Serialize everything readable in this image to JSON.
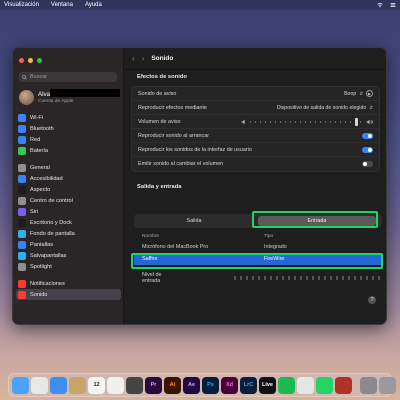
{
  "menubar": {
    "app": "Visualización",
    "items": [
      "Ventana",
      "Ayuda"
    ]
  },
  "window": {
    "title": "Sonido",
    "back_icon": "chevron-left-icon",
    "forward_icon": "chevron-right-icon"
  },
  "sidebar": {
    "search_placeholder": "Buscar",
    "user": {
      "name": "Alvaro",
      "subtitle": "Cuenta de Apple"
    },
    "items": [
      {
        "label": "Wi-Fi",
        "icon": "wifi-icon",
        "color": "#3b82f6"
      },
      {
        "label": "Bluetooth",
        "icon": "bluetooth-icon",
        "color": "#3b82f6"
      },
      {
        "label": "Red",
        "icon": "globe-icon",
        "color": "#3b82f6"
      },
      {
        "label": "Batería",
        "icon": "battery-icon",
        "color": "#34c759"
      },
      {
        "label": "General",
        "icon": "gear-icon",
        "color": "#8e8e93"
      },
      {
        "label": "Accesibilidad",
        "icon": "accessibility-icon",
        "color": "#3b82f6"
      },
      {
        "label": "Aspecto",
        "icon": "appearance-icon",
        "color": "#1c1c1e"
      },
      {
        "label": "Centro de control",
        "icon": "control-center-icon",
        "color": "#8e8e93"
      },
      {
        "label": "Siri",
        "icon": "siri-icon",
        "color": "#7d5cf0"
      },
      {
        "label": "Escritorio y Dock",
        "icon": "desktop-dock-icon",
        "color": "#1c1c1e"
      },
      {
        "label": "Fondo de pantalla",
        "icon": "wallpaper-icon",
        "color": "#30b0e8"
      },
      {
        "label": "Pantallas",
        "icon": "display-icon",
        "color": "#3b82f6"
      },
      {
        "label": "Salvapantallas",
        "icon": "screensaver-icon",
        "color": "#30b0e8"
      },
      {
        "label": "Spotlight",
        "icon": "spotlight-icon",
        "color": "#8e8e93"
      },
      {
        "label": "Notificaciones",
        "icon": "notifications-icon",
        "color": "#ff3b30"
      },
      {
        "label": "Sonido",
        "icon": "speaker-icon",
        "color": "#ff3b30"
      }
    ],
    "active": "Sonido"
  },
  "effects": {
    "section_title": "Efectos de sonido",
    "alert_sound_label": "Sonido de aviso",
    "alert_sound_value": "Boop",
    "play_through_label": "Reproducir efectos mediante",
    "play_through_value": "Dispositivo de salida de sonido elegido",
    "alert_volume_label": "Volumen de aviso",
    "alert_volume_level": 0.95,
    "startup_label": "Reproducir sonido al arrancar",
    "startup_on": true,
    "ui_sounds_label": "Reproducir los sonidos de la interfaz de usuario",
    "ui_sounds_on": true,
    "feedback_label": "Emitir sonido al cambiar el volumen",
    "feedback_on": false
  },
  "io": {
    "section_title": "Salida y entrada",
    "tabs": [
      "Salida",
      "Entrada"
    ],
    "selected_tab": "Entrada",
    "columns": [
      "Nombre",
      "Tipo"
    ],
    "devices": [
      {
        "name": "Micrófono del MacBook Pro",
        "type": "Integrado",
        "selected": false
      },
      {
        "name": "Saffire",
        "type": "FireWire",
        "selected": true
      }
    ],
    "input_level_label": "Nivel de entrada",
    "help": "?"
  },
  "dock": {
    "items": [
      {
        "label": "Finder",
        "icon": "finder-icon",
        "color": "#4aa3ff"
      },
      {
        "label": "Chrome",
        "icon": "chrome-icon",
        "color": "#e8e8e8"
      },
      {
        "label": "Mail",
        "icon": "mail-icon",
        "color": "#3d8ef0"
      },
      {
        "label": "Contactos",
        "icon": "contacts-icon",
        "color": "#c9a46a"
      },
      {
        "label": "12",
        "icon": "calendar-icon",
        "color": "#f4f4f4"
      },
      {
        "label": "Notas",
        "icon": "notes-icon",
        "color": "#f0f0f0"
      },
      {
        "label": "Calculadora",
        "icon": "calculator-icon",
        "color": "#444"
      },
      {
        "label": "Pr",
        "icon": "premiere-icon",
        "color": "#2a0a3d"
      },
      {
        "label": "Ai",
        "icon": "illustrator-icon",
        "color": "#3a1400"
      },
      {
        "label": "Ae",
        "icon": "after-effects-icon",
        "color": "#1f0a3d"
      },
      {
        "label": "Ps",
        "icon": "photoshop-icon",
        "color": "#061e3a"
      },
      {
        "label": "Xd",
        "icon": "xd-icon",
        "color": "#470137"
      },
      {
        "label": "LrC",
        "icon": "lightroom-icon",
        "color": "#0b1f3a"
      },
      {
        "label": "Live",
        "icon": "ableton-icon",
        "color": "#111"
      },
      {
        "label": "Spotify",
        "icon": "spotify-icon",
        "color": "#1db954"
      },
      {
        "label": "Camo",
        "icon": "camo-icon",
        "color": "#e6e6e6"
      },
      {
        "label": "WhatsApp",
        "icon": "whatsapp-icon",
        "color": "#25d366"
      },
      {
        "label": "FileZilla",
        "icon": "filezilla-icon",
        "color": "#b0302a"
      },
      {
        "label": "Preferencias",
        "icon": "settings-app-icon",
        "color": "#8a8a8e"
      },
      {
        "label": "Papelera",
        "icon": "trash-icon",
        "color": "#9a9a9e"
      }
    ]
  }
}
